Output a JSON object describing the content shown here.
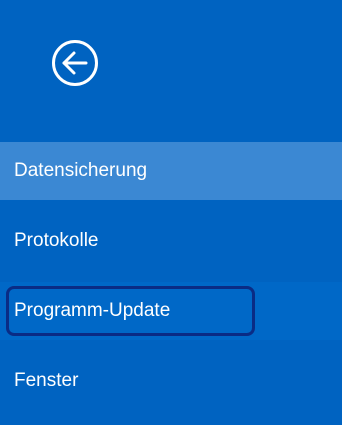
{
  "header": {
    "back_icon": "arrow-left-circle-icon"
  },
  "nav": {
    "items": [
      {
        "label": "Datensicherung",
        "state": "selected"
      },
      {
        "label": "Protokolle",
        "state": "normal"
      },
      {
        "label": "Programm-Update",
        "state": "highlighted"
      },
      {
        "label": "Fenster",
        "state": "normal"
      }
    ]
  },
  "colors": {
    "background": "#0063c1",
    "selected": "#3b88d3",
    "highlight_border": "#0a2c85",
    "text": "#ffffff"
  }
}
